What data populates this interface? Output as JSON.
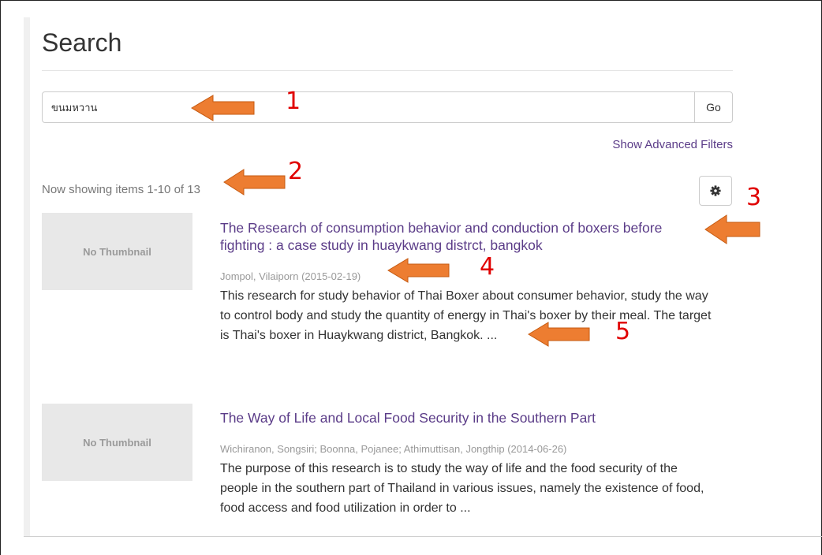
{
  "page": {
    "title": "Search"
  },
  "search": {
    "value": "ขนมหวาน",
    "go_label": "Go",
    "advanced_filters_label": "Show Advanced Filters"
  },
  "results": {
    "count_text": "Now showing items 1-10 of 13",
    "settings_icon": "gear-icon",
    "items": [
      {
        "thumbnail_text": "No Thumbnail",
        "title_line1": "The Research of consumption behavior and conduction of boxers before",
        "title_line2": "fighting : a case study in huaykwang distrct, bangkok",
        "authors": "Jompol, Vilaiporn (2015-02-19)",
        "abstract_line1": "This research for study behavior of Thai Boxer about consumer behavior, study the way",
        "abstract_line2": "to control body and study the quantity of energy in Thai's boxer by their meal. The target",
        "abstract_line3": "is Thai's boxer in Huaykwang district, Bangkok. ..."
      },
      {
        "thumbnail_text": "No Thumbnail",
        "title_line1": "The Way of Life and Local Food Security in the Southern Part",
        "authors": "Wichiranon, Songsiri; Boonna, Pojanee; Athimuttisan, Jongthip (2014-06-26)",
        "abstract_line1": "The purpose of this research is to study the way of life and the food security of the",
        "abstract_line2": "people in the southern part of Thailand in various issues, namely the existence of food,",
        "abstract_line3": "food access and food utilization in order to ..."
      }
    ]
  },
  "annotations": {
    "color_arrow": "#ed7d31",
    "color_number": "#e00000",
    "labels": [
      "1",
      "2",
      "3",
      "4",
      "5"
    ]
  }
}
